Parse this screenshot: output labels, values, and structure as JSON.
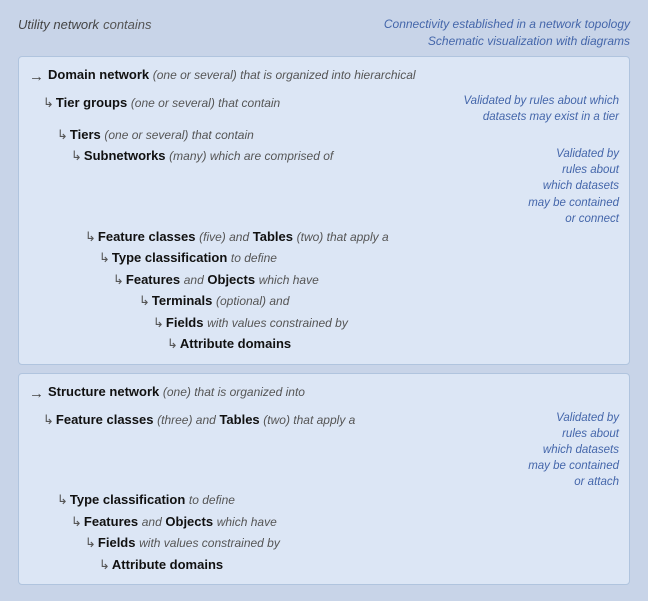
{
  "header": {
    "utility_title": "Utility network",
    "utility_contains": "contains",
    "connectivity_line1": "Connectivity established in a network topology",
    "connectivity_line2": "Schematic visualization with diagrams"
  },
  "domain_section": {
    "title": "Domain network",
    "title_italic": "(one or several) that is organized into hierarchical",
    "tier_groups_label": "Tier groups",
    "tier_groups_italic": "(one or several) that contain",
    "validated_tier": "Validated by rules about which datasets may exist in a tier",
    "tiers_label": "Tiers",
    "tiers_italic": "(one or several) that contain",
    "subnetworks_label": "Subnetworks",
    "subnetworks_italic": "(many) which are comprised of",
    "validated_subnetworks_line1": "Validated by",
    "validated_subnetworks_line2": "rules about",
    "validated_subnetworks_line3": "which datasets",
    "validated_subnetworks_line4": "may be contained",
    "validated_subnetworks_line5": "or connect",
    "feature_classes_label": "Feature classes",
    "feature_classes_italic": "(five) and",
    "tables_label": "Tables",
    "tables_italic": "(two) that apply a",
    "type_class_label": "Type classification",
    "type_class_italic": "to define",
    "features_label": "Features",
    "features_italic": "and",
    "objects_label": "Objects",
    "objects_italic": "which have",
    "terminals_label": "Terminals",
    "terminals_italic": "(optional) and",
    "fields_label": "Fields",
    "fields_italic": "with values constrained by",
    "attr_domains_label": "Attribute domains"
  },
  "structure_section": {
    "title": "Structure network",
    "title_italic": "(one) that is organized into",
    "feature_classes_label": "Feature classes",
    "feature_classes_italic": "(three) and",
    "tables_label": "Tables",
    "tables_italic": "(two) that apply a",
    "validated_line1": "Validated by",
    "validated_line2": "rules about",
    "validated_line3": "which datasets",
    "validated_line4": "may be contained",
    "validated_line5": "or attach",
    "type_class_label": "Type classification",
    "type_class_italic": "to define",
    "features_label": "Features",
    "features_italic": "and",
    "objects_label": "Objects",
    "objects_italic": "which have",
    "fields_label": "Fields",
    "fields_italic": "with values constrained by",
    "attr_domains_label": "Attribute domains"
  }
}
